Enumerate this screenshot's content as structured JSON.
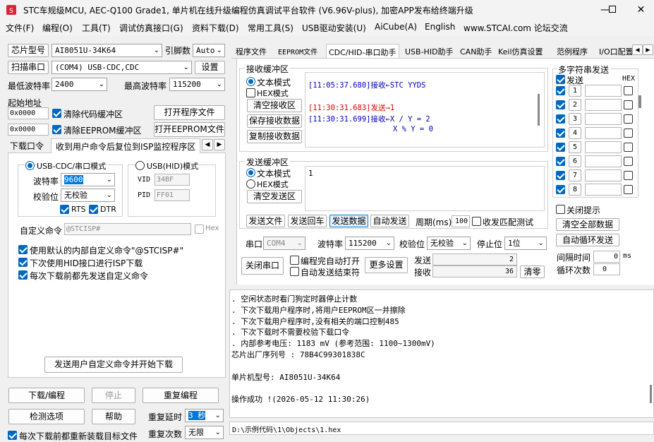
{
  "window": {
    "title": "STC车规级MCU, AEC-Q100 Grade1, 单片机在线升级编程仿真调试平台软件 (V6.96V-plus), 加密APP发布给终端升级"
  },
  "menu": [
    "文件(F)",
    "编程(O)",
    "工具(T)",
    "调试仿真接口(G)",
    "资料下载(D)",
    "常用工具(S)",
    "USB驱动安装(U)",
    "AiCube(A)",
    "English",
    "www.STCAI.com 论坛交流"
  ],
  "left": {
    "chip_label": "芯片型号",
    "chip_value": "AI8051U-34K64",
    "pins_label": "引脚数",
    "pins_value": "Auto",
    "scan_btn": "扫描串口",
    "port_value": "(COM4) USB-CDC,CDC",
    "settings_btn": "设置",
    "min_baud_label": "最低波特率",
    "min_baud": "2400",
    "max_baud_label": "最高波特率",
    "max_baud": "115200",
    "start_addr_label": "起始地址",
    "addr1": "0x0000",
    "addr2": "0x0000",
    "clear_code": "清除代码缓冲区",
    "clear_eeprom": "清除EEPROM缓冲区",
    "open_prog": "打开程序文件",
    "open_eeprom": "打开EEPROM文件",
    "subtab1": "下载口令",
    "subtab2": "收到用户命令后复位到ISP监控程序区",
    "usb_cdc": "USB-CDC/串口模式",
    "usb_hid": "USB(HID)模式",
    "baud_label": "波特率",
    "baud_value": "9600",
    "parity_label": "校验位",
    "parity_value": "无校验",
    "rts": "RTS",
    "dtr": "DTR",
    "vid_label": "VID",
    "vid_value": "34BF",
    "pid_label": "PID",
    "pid_value": "FF01",
    "custom_cmd_label": "自定义命令",
    "custom_cmd_value": "@STCISP#",
    "hex_label": "Hex",
    "opt1": "使用默认的内部自定义命令\"@STCISP#\"",
    "opt2": "下次使用HID接口进行ISP下载",
    "opt3": "每次下载前都先发送自定义命令",
    "send_custom_btn": "发送用户自定义命令并开始下载",
    "download_btn": "下载/编程",
    "stop_btn": "停止",
    "reprog_btn": "重复编程",
    "detect_btn": "检测选项",
    "help_btn": "帮助",
    "repeat_delay_label": "重复延时",
    "repeat_delay_value": "3 秒",
    "reload_label": "每次下载前都重新装载目标文件",
    "repeat_count_label": "重复次数",
    "repeat_count_value": "无限"
  },
  "tabs": [
    "程序文件",
    "EEPROM文件",
    "CDC/HID-串口助手",
    "USB-HID助手",
    "CAN助手",
    "Keil仿真设置",
    "范例程序",
    "I/O口配置"
  ],
  "recv": {
    "group": "接收缓冲区",
    "text_mode": "文本模式",
    "hex_mode": "HEX模式",
    "clear_btn": "清空接收区",
    "save_btn": "保存接收数据",
    "copy_btn": "复制接收数据",
    "lines": [
      {
        "time": "[11:05:37.680]",
        "tag": "接收←",
        "text": "STC YYDS",
        "color": "#0000c0"
      },
      {
        "time": "[11:30:31.683]",
        "tag": "发送→",
        "text": "1",
        "color": "#e00000"
      },
      {
        "time": "[11:30:31.699]",
        "tag": "接收←",
        "text": "X / Y = 2",
        "color": "#0000c0"
      },
      {
        "time": "",
        "tag": "",
        "text": "X % Y = 0",
        "color": "#0000c0"
      }
    ]
  },
  "send": {
    "group": "发送缓冲区",
    "text_mode": "文本模式",
    "hex_mode": "HEX模式",
    "clear_btn": "清空发送区",
    "content": "1",
    "send_file": "发送文件",
    "send_cr": "发送回车",
    "send_data": "发送数据",
    "auto_send": "自动发送",
    "period_label": "周期(ms)",
    "period_value": "100",
    "match_label": "收发匹配测试"
  },
  "serial": {
    "port_label": "串口",
    "port_value": "COM4",
    "baud_label": "波特率",
    "baud_value": "115200",
    "parity_label": "校验位",
    "parity_value": "无校验",
    "stop_label": "停止位",
    "stop_value": "1位",
    "close_btn": "关闭串口",
    "auto_open": "编程完自动打开",
    "auto_close": "自动发送结束符",
    "more_btn": "更多设置",
    "send_label": "发送",
    "send_count": "2",
    "recv_label": "接收",
    "recv_count": "36",
    "clear_btn": "清零"
  },
  "multi": {
    "title": "多字符串发送",
    "send_label": "发送",
    "hex_label": "HEX",
    "rows": [
      "1",
      "2",
      "3",
      "4",
      "5",
      "6",
      "7",
      "8"
    ],
    "close_tip": "关闭提示",
    "clear_all": "清空全部数据",
    "auto_loop": "自动循环发送",
    "interval_label": "间隔时间",
    "interval_value": "0",
    "ms": "ms",
    "loop_label": "循环次数",
    "loop_value": "0"
  },
  "log": {
    "lines": [
      "  . 空闲状态时看门狗定时器停止计数",
      "  . 下次下载用户程序时,将用户EEPROM区一并擦除",
      "  . 下次下载用户程序时,没有相关的端口控制485",
      "  . 下次下载时不需要校验下载口令",
      "  . 内部参考电压: 1183 mV (参考范围: 1100~1300mV)",
      "芯片出厂序列号 : 78B4C99301838C",
      "",
      "  单片机型号: AI8051U-34K64",
      "",
      "操作成功 !(2026-05-12 11:30:26)"
    ],
    "path": "D:\\示例代码\\1\\Objects\\1.hex"
  }
}
